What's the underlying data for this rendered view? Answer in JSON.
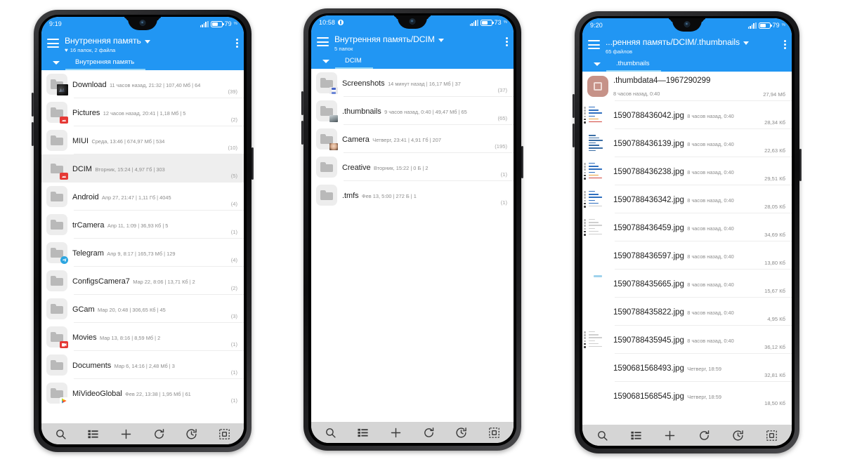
{
  "phones": [
    {
      "id": "phone-1",
      "status": {
        "time": "9:19",
        "battery_pct": "79",
        "battery_pct_small": "%",
        "opera_icon": false
      },
      "appbar": {
        "title": "Внутренняя память",
        "subtitle": "16 папок, 2 файла",
        "heart": "♥",
        "menu_icon": "hamburger-icon",
        "overflow_icon": "kebab-menu-icon",
        "dropdown_icon": "chevron-down-icon"
      },
      "tab": {
        "label": "Внутренняя память"
      },
      "rows": [
        {
          "name": "Download",
          "info": "11 часов назад, 21:32 | 107,40 Мб | 64",
          "count": "(39)",
          "icon": "folder-icon",
          "badge": "image-preview"
        },
        {
          "name": "Pictures",
          "info": "12 часов назад, 20:41 | 1,18 Мб | 5",
          "count": "(2)",
          "icon": "folder-icon",
          "badge": "image"
        },
        {
          "name": "MIUI",
          "info": "Среда, 13:46 | 674,97 Мб | 534",
          "count": "(10)",
          "icon": "folder-icon",
          "badge": "none"
        },
        {
          "name": "DCIM",
          "info": "Вторник, 15:24 | 4,97 Гб | 303",
          "count": "(5)",
          "icon": "folder-icon",
          "badge": "image",
          "selected": true
        },
        {
          "name": "Android",
          "info": "Апр 27, 21:47 | 1,11 Гб | 4045",
          "count": "(4)",
          "icon": "folder-icon",
          "badge": "none"
        },
        {
          "name": "trCamera",
          "info": "Апр 11, 1:09 | 36,93 Кб | 5",
          "count": "(1)",
          "icon": "folder-icon",
          "badge": "none"
        },
        {
          "name": "Telegram",
          "info": "Апр 9, 8:17 | 165,73 Мб | 129",
          "count": "(4)",
          "icon": "folder-icon",
          "badge": "telegram"
        },
        {
          "name": "ConfigsCamera7",
          "info": "Мар 22, 8:06 | 13,71 Кб | 2",
          "count": "(2)",
          "icon": "folder-icon",
          "badge": "none"
        },
        {
          "name": "GCam",
          "info": "Мар 20, 0:48 | 306,65 Кб | 45",
          "count": "(3)",
          "icon": "folder-icon",
          "badge": "none"
        },
        {
          "name": "Movies",
          "info": "Мар 13, 8:16 | 8,59 Мб | 2",
          "count": "(1)",
          "icon": "folder-icon",
          "badge": "video"
        },
        {
          "name": "Documents",
          "info": "Мар 6, 14:16 | 2,48 Мб | 3",
          "count": "(1)",
          "icon": "folder-icon",
          "badge": "none"
        },
        {
          "name": "MiVideoGlobal",
          "info": "Фев 22, 13:38 | 1,95 Мб | 61",
          "count": "(1)",
          "icon": "folder-icon",
          "badge": "play"
        }
      ]
    },
    {
      "id": "phone-2",
      "status": {
        "time": "10:58",
        "battery_pct": "73",
        "battery_pct_small": "%",
        "opera_icon": true
      },
      "appbar": {
        "title": "Внутренняя память/DCIM",
        "subtitle": "5 папок",
        "heart": "",
        "menu_icon": "hamburger-icon",
        "overflow_icon": "kebab-menu-icon",
        "dropdown_icon": "chevron-down-icon"
      },
      "tab": {
        "label": "DCIM"
      },
      "rows": [
        {
          "name": "Screenshots",
          "info": "14 минут назад | 16,17 Мб | 37",
          "count": "(37)",
          "icon": "folder-icon",
          "badge": "screenshot"
        },
        {
          "name": ".thumbnails",
          "info": "9 часов назад, 0:40 | 49,47 Мб | 65",
          "count": "(65)",
          "icon": "folder-icon",
          "badge": "room"
        },
        {
          "name": "Camera",
          "info": "Четверг, 23:41 | 4,91 Гб | 207",
          "count": "(195)",
          "icon": "folder-icon",
          "badge": "face"
        },
        {
          "name": "Creative",
          "info": "Вторник, 15:22 | 0 Б | 2",
          "count": "(1)",
          "icon": "folder-icon",
          "badge": "none"
        },
        {
          "name": ".tmfs",
          "info": "Фев 13, 5:00 | 272 Б | 1",
          "count": "(1)",
          "icon": "folder-icon",
          "badge": "none"
        }
      ]
    },
    {
      "id": "phone-3",
      "status": {
        "time": "9:20",
        "battery_pct": "79",
        "battery_pct_small": "%",
        "opera_icon": false
      },
      "appbar": {
        "title": "...ренняя память/DCIM/.thumbnails",
        "subtitle": "65 файлов",
        "heart": "",
        "menu_icon": "hamburger-icon",
        "overflow_icon": "kebab-menu-icon",
        "dropdown_icon": "chevron-down-icon"
      },
      "tab": {
        "label": ".thumbnails"
      },
      "rows": [
        {
          "name": ".thumbdata4—1967290299",
          "info": "8 часов назад, 0:40",
          "size": "27,94 Мб",
          "icon": "file-icon",
          "art": "rose"
        },
        {
          "name": "1590788436042.jpg",
          "info": "8 часов назад, 0:40",
          "size": "28,34 Кб",
          "icon": "image-icon",
          "art": "doc-a"
        },
        {
          "name": "1590788436139.jpg",
          "info": "8 часов назад, 0:40",
          "size": "22,63 Кб",
          "icon": "image-icon",
          "art": "gray-doc"
        },
        {
          "name": "1590788436238.jpg",
          "info": "8 часов назад, 0:40",
          "size": "29,51 Кб",
          "icon": "image-icon",
          "art": "doc-a"
        },
        {
          "name": "1590788436342.jpg",
          "info": "8 часов назад, 0:40",
          "size": "28,05 Кб",
          "icon": "image-icon",
          "art": "doc-b"
        },
        {
          "name": "1590788436459.jpg",
          "info": "8 часов назад, 0:40",
          "size": "34,69 Кб",
          "icon": "image-icon",
          "art": "doc-c"
        },
        {
          "name": "1590788436597.jpg",
          "info": "8 часов назад, 0:40",
          "size": "13,80 Кб",
          "icon": "image-icon",
          "art": "metal"
        },
        {
          "name": "1590788435665.jpg",
          "info": "8 часов назад, 0:40",
          "size": "15,67 Кб",
          "icon": "image-icon",
          "art": "light-blue"
        },
        {
          "name": "1590788435822.jpg",
          "info": "8 часов назад, 0:40",
          "size": "4,95 Кб",
          "icon": "image-icon",
          "art": "blue-grad"
        },
        {
          "name": "1590788435945.jpg",
          "info": "8 часов назад, 0:40",
          "size": "36,12 Кб",
          "icon": "image-icon",
          "art": "doc-c"
        },
        {
          "name": "1590681568493.jpg",
          "info": "Четверг, 18:59",
          "size": "32,81 Кб",
          "icon": "image-icon",
          "art": "nature1"
        },
        {
          "name": "1590681568545.jpg",
          "info": "Четверг, 18:59",
          "size": "18,50 Кб",
          "icon": "image-icon",
          "art": "nature2"
        }
      ]
    }
  ],
  "bottombar": {
    "items": [
      {
        "icon": "search-icon",
        "label": "Поиск"
      },
      {
        "icon": "list-icon",
        "label": "Список"
      },
      {
        "icon": "plus-icon",
        "label": "Создать"
      },
      {
        "icon": "refresh-icon",
        "label": "Обновить"
      },
      {
        "icon": "history-icon",
        "label": "История"
      },
      {
        "icon": "select-icon",
        "label": "Выделить"
      }
    ]
  },
  "colors": {
    "accent": "#2196f3",
    "tab_underline": "#90d4f7",
    "bottombar": "#d5d5d5",
    "list_bg": "#ffffff",
    "selected_row": "#eeeeee"
  }
}
